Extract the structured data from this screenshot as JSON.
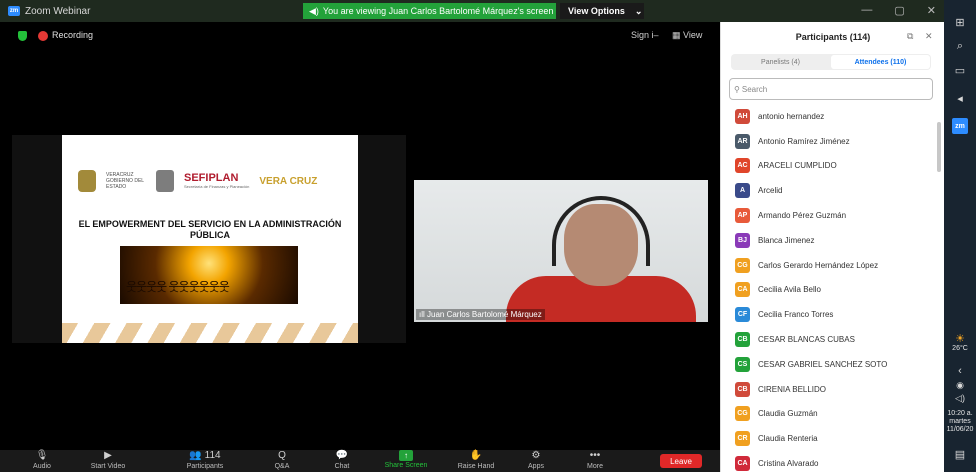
{
  "window": {
    "title": "Zoom Webinar",
    "viewing_banner": "You are viewing Juan Carlos Bartolomé Márquez's screen",
    "view_options": "View Options",
    "controls": [
      "—",
      "▢",
      "✕"
    ]
  },
  "meeting": {
    "recording": "Recording",
    "sign_in": "Sign i–",
    "view": "View"
  },
  "slide": {
    "logo_veracruz": "VERACRUZ GOBIERNO DEL ESTADO",
    "logo_sefiplan": "SEFIPLAN",
    "logo_sefiplan_sub": "Secretaría de Finanzas y Planeación",
    "logo_vera": "VERA CRUZ",
    "title": "EL EMPOWERMENT DEL SERVICIO EN LA ADMINISTRACIÓN PÚBLICA"
  },
  "video": {
    "name": "Juan Carlos Bartolomé Márquez"
  },
  "toolbar": {
    "items": [
      {
        "label": "Audio",
        "icon": "microphone-icon",
        "glyph": "🎙"
      },
      {
        "label": "Start Video",
        "icon": "video-off-icon",
        "glyph": "▶"
      },
      {
        "label": "Participants",
        "icon": "participants-icon",
        "glyph": "👥 114"
      },
      {
        "label": "Q&A",
        "icon": "qa-icon",
        "glyph": "Q"
      },
      {
        "label": "Chat",
        "icon": "chat-icon",
        "glyph": "💬"
      },
      {
        "label": "Share Screen",
        "icon": "share-screen-icon",
        "glyph": "↑"
      },
      {
        "label": "Raise Hand",
        "icon": "raise-hand-icon",
        "glyph": "✋"
      },
      {
        "label": "Apps",
        "icon": "apps-icon",
        "glyph": "⚙"
      },
      {
        "label": "More",
        "icon": "more-icon",
        "glyph": "•••"
      }
    ],
    "leave": "Leave"
  },
  "panel": {
    "title": "Participants (114)",
    "tab_panelists": "Panelists (4)",
    "tab_attendees": "Attendees (110)",
    "search_placeholder": "Search",
    "participants": [
      {
        "initials": "AH",
        "name": "antonio hernandez",
        "color": "#d04a3a"
      },
      {
        "initials": "AR",
        "name": "Antonio Ramírez Jiménez",
        "color": "#4a5a6a"
      },
      {
        "initials": "AC",
        "name": "ARACELI CUMPLIDO",
        "color": "#e0452a"
      },
      {
        "initials": "A",
        "name": "Arcelid",
        "color": "#3a4a8a"
      },
      {
        "initials": "AP",
        "name": "Armando Pérez Guzmán",
        "color": "#e85a3a"
      },
      {
        "initials": "BJ",
        "name": "Blanca Jimenez",
        "color": "#8a3ab8"
      },
      {
        "initials": "CG",
        "name": "Carlos Gerardo Hernández López",
        "color": "#f0a020"
      },
      {
        "initials": "CA",
        "name": "Cecilia Avila Bello",
        "color": "#f0a020"
      },
      {
        "initials": "CF",
        "name": "Cecilia Franco Torres",
        "color": "#2a8ad8"
      },
      {
        "initials": "CB",
        "name": "CESAR BLANCAS CUBAS",
        "color": "#23a23a"
      },
      {
        "initials": "CS",
        "name": "CESAR GABRIEL SANCHEZ SOTO",
        "color": "#23a23a"
      },
      {
        "initials": "CB",
        "name": "CIRENIA BELLIDO",
        "color": "#d04a3a"
      },
      {
        "initials": "CG",
        "name": "Claudia Guzmán",
        "color": "#f0a020"
      },
      {
        "initials": "CR",
        "name": "Claudia Renteria",
        "color": "#f0a020"
      },
      {
        "initials": "CA",
        "name": "Cristina Alvarado",
        "color": "#d02a3a"
      }
    ]
  },
  "os": {
    "temp": "26°C",
    "time": "10:20 a.",
    "day": "martes",
    "date": "11/06/20"
  }
}
